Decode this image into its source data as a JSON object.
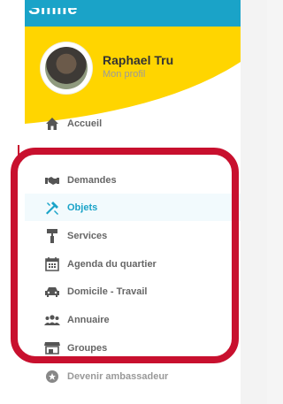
{
  "app": {
    "logo": "Smile"
  },
  "profile": {
    "name": "Raphael Tru",
    "link": "Mon profil"
  },
  "nav": {
    "items": [
      {
        "label": "Accueil",
        "icon": "home-icon"
      },
      {
        "label": "Demandes",
        "icon": "handshake-icon"
      },
      {
        "label": "Objets",
        "icon": "tools-icon",
        "active": true
      },
      {
        "label": "Services",
        "icon": "paint-roller-icon"
      },
      {
        "label": "Agenda du quartier",
        "icon": "calendar-icon"
      },
      {
        "label": "Domicile - Travail",
        "icon": "car-icon"
      },
      {
        "label": "Annuaire",
        "icon": "users-icon"
      },
      {
        "label": "Groupes",
        "icon": "store-icon"
      },
      {
        "label": "Devenir ambassadeur",
        "icon": "badge-icon"
      }
    ]
  },
  "colors": {
    "brand": "#1aa3c8",
    "yellow": "#ffd500",
    "highlight": "#c8102e"
  }
}
